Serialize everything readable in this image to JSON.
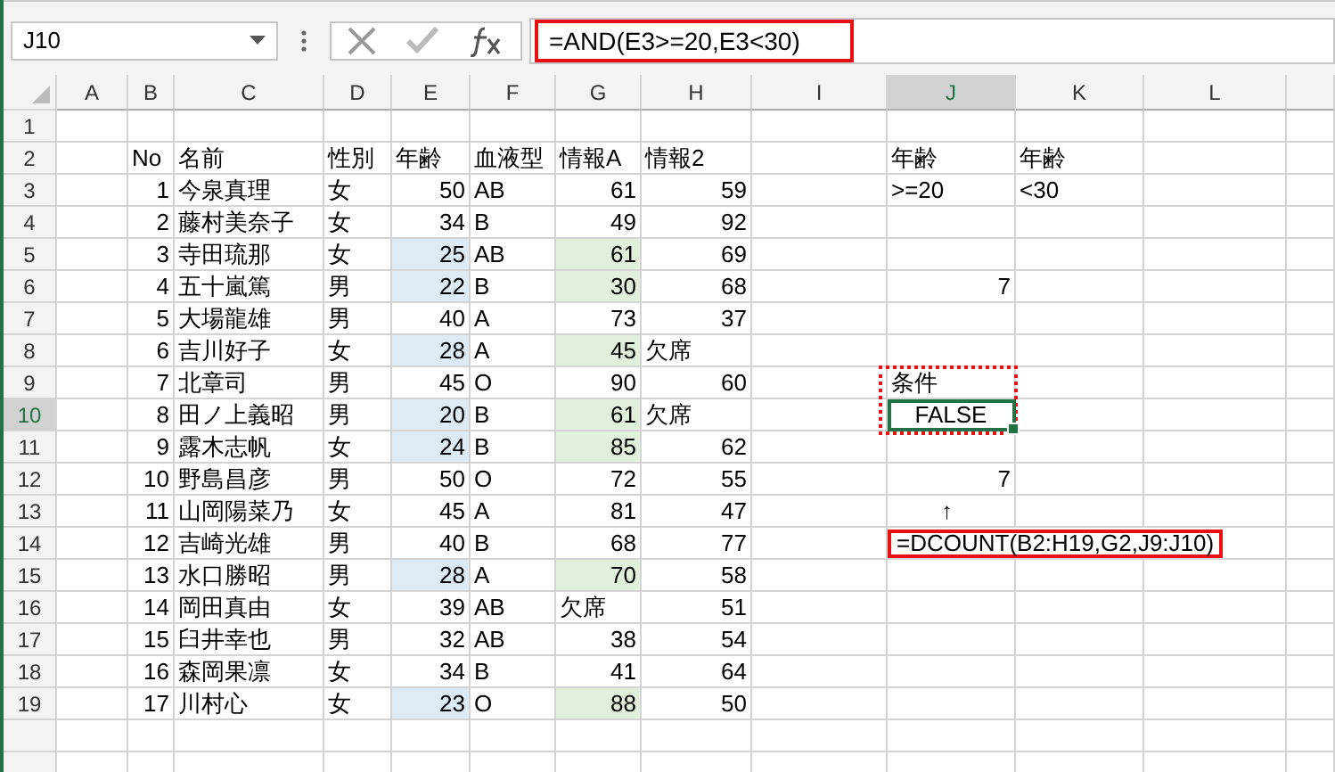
{
  "name_box": {
    "value": "J10"
  },
  "formula_bar": {
    "value": "=AND(E3>=20,E3<30)",
    "highlighted": true
  },
  "sheet": {
    "columns": [
      {
        "label": "A",
        "selected": false
      },
      {
        "label": "B",
        "selected": false
      },
      {
        "label": "C",
        "selected": false
      },
      {
        "label": "D",
        "selected": false
      },
      {
        "label": "E",
        "selected": false
      },
      {
        "label": "F",
        "selected": false
      },
      {
        "label": "G",
        "selected": false
      },
      {
        "label": "H",
        "selected": false
      },
      {
        "label": "I",
        "selected": false
      },
      {
        "label": "J",
        "selected": true
      },
      {
        "label": "K",
        "selected": false
      },
      {
        "label": "L",
        "selected": false
      }
    ],
    "rows": [
      {
        "number": "1",
        "selected": false,
        "cells": {}
      },
      {
        "number": "2",
        "selected": false,
        "cells": {
          "B": {
            "text": "No",
            "kind": "text"
          },
          "C": {
            "text": "名前",
            "kind": "text"
          },
          "D": {
            "text": "性別",
            "kind": "text"
          },
          "E": {
            "text": "年齢",
            "kind": "text"
          },
          "F": {
            "text": "血液型",
            "kind": "text"
          },
          "G": {
            "text": "情報A",
            "kind": "text"
          },
          "H": {
            "text": "情報2",
            "kind": "text"
          },
          "J": {
            "text": "年齢",
            "kind": "text"
          },
          "K": {
            "text": "年齢",
            "kind": "text"
          }
        }
      },
      {
        "number": "3",
        "selected": false,
        "cells": {
          "B": {
            "text": "1",
            "kind": "number"
          },
          "C": {
            "text": "今泉真理",
            "kind": "text"
          },
          "D": {
            "text": "女",
            "kind": "text"
          },
          "E": {
            "text": "50",
            "kind": "number"
          },
          "F": {
            "text": "AB",
            "kind": "text"
          },
          "G": {
            "text": "61",
            "kind": "number"
          },
          "H": {
            "text": "59",
            "kind": "number"
          },
          "J": {
            "text": ">=20",
            "kind": "text"
          },
          "K": {
            "text": "<30",
            "kind": "text"
          }
        }
      },
      {
        "number": "4",
        "selected": false,
        "cells": {
          "B": {
            "text": "2",
            "kind": "number"
          },
          "C": {
            "text": "藤村美奈子",
            "kind": "text"
          },
          "D": {
            "text": "女",
            "kind": "text"
          },
          "E": {
            "text": "34",
            "kind": "number"
          },
          "F": {
            "text": "B",
            "kind": "text"
          },
          "G": {
            "text": "49",
            "kind": "number"
          },
          "H": {
            "text": "92",
            "kind": "number"
          }
        }
      },
      {
        "number": "5",
        "selected": false,
        "cells": {
          "B": {
            "text": "3",
            "kind": "number"
          },
          "C": {
            "text": "寺田琉那",
            "kind": "text"
          },
          "D": {
            "text": "女",
            "kind": "text"
          },
          "E": {
            "text": "25",
            "kind": "number",
            "color": "#ddebf7"
          },
          "F": {
            "text": "AB",
            "kind": "text"
          },
          "G": {
            "text": "61",
            "kind": "number",
            "color": "#e2efda"
          },
          "H": {
            "text": "69",
            "kind": "number"
          }
        }
      },
      {
        "number": "6",
        "selected": false,
        "cells": {
          "B": {
            "text": "4",
            "kind": "number"
          },
          "C": {
            "text": "五十嵐篤",
            "kind": "text"
          },
          "D": {
            "text": "男",
            "kind": "text"
          },
          "E": {
            "text": "22",
            "kind": "number",
            "color": "#ddebf7"
          },
          "F": {
            "text": "B",
            "kind": "text"
          },
          "G": {
            "text": "30",
            "kind": "number",
            "color": "#e2efda"
          },
          "H": {
            "text": "68",
            "kind": "number"
          },
          "J": {
            "text": "7",
            "kind": "number"
          }
        }
      },
      {
        "number": "7",
        "selected": false,
        "cells": {
          "B": {
            "text": "5",
            "kind": "number"
          },
          "C": {
            "text": "大場龍雄",
            "kind": "text"
          },
          "D": {
            "text": "男",
            "kind": "text"
          },
          "E": {
            "text": "40",
            "kind": "number"
          },
          "F": {
            "text": "A",
            "kind": "text"
          },
          "G": {
            "text": "73",
            "kind": "number"
          },
          "H": {
            "text": "37",
            "kind": "number"
          }
        }
      },
      {
        "number": "8",
        "selected": false,
        "cells": {
          "B": {
            "text": "6",
            "kind": "number"
          },
          "C": {
            "text": "吉川好子",
            "kind": "text"
          },
          "D": {
            "text": "女",
            "kind": "text"
          },
          "E": {
            "text": "28",
            "kind": "number",
            "color": "#ddebf7"
          },
          "F": {
            "text": "A",
            "kind": "text"
          },
          "G": {
            "text": "45",
            "kind": "number",
            "color": "#e2efda"
          },
          "H": {
            "text": "欠席",
            "kind": "text"
          }
        }
      },
      {
        "number": "9",
        "selected": false,
        "cells": {
          "B": {
            "text": "7",
            "kind": "number"
          },
          "C": {
            "text": "北章司",
            "kind": "text"
          },
          "D": {
            "text": "男",
            "kind": "text"
          },
          "E": {
            "text": "45",
            "kind": "number"
          },
          "F": {
            "text": "O",
            "kind": "text"
          },
          "G": {
            "text": "90",
            "kind": "number"
          },
          "H": {
            "text": "60",
            "kind": "number"
          },
          "J": {
            "text": "条件",
            "kind": "text",
            "framed": true
          }
        }
      },
      {
        "number": "10",
        "selected": true,
        "cells": {
          "B": {
            "text": "8",
            "kind": "number"
          },
          "C": {
            "text": "田ノ上義昭",
            "kind": "text"
          },
          "D": {
            "text": "男",
            "kind": "text"
          },
          "E": {
            "text": "20",
            "kind": "number",
            "color": "#ddebf7"
          },
          "F": {
            "text": "B",
            "kind": "text"
          },
          "G": {
            "text": "61",
            "kind": "number",
            "color": "#e2efda"
          },
          "H": {
            "text": "欠席",
            "kind": "text"
          },
          "J": {
            "text": "FALSE",
            "kind": "boolean",
            "framed": true
          }
        }
      },
      {
        "number": "11",
        "selected": false,
        "cells": {
          "B": {
            "text": "9",
            "kind": "number"
          },
          "C": {
            "text": "露木志帆",
            "kind": "text"
          },
          "D": {
            "text": "女",
            "kind": "text"
          },
          "E": {
            "text": "24",
            "kind": "number",
            "color": "#ddebf7"
          },
          "F": {
            "text": "B",
            "kind": "text"
          },
          "G": {
            "text": "85",
            "kind": "number",
            "color": "#e2efda"
          },
          "H": {
            "text": "62",
            "kind": "number"
          }
        }
      },
      {
        "number": "12",
        "selected": false,
        "cells": {
          "B": {
            "text": "10",
            "kind": "number"
          },
          "C": {
            "text": "野島昌彦",
            "kind": "text"
          },
          "D": {
            "text": "男",
            "kind": "text"
          },
          "E": {
            "text": "50",
            "kind": "number"
          },
          "F": {
            "text": "O",
            "kind": "text"
          },
          "G": {
            "text": "72",
            "kind": "number"
          },
          "H": {
            "text": "55",
            "kind": "number"
          },
          "J": {
            "text": "7",
            "kind": "number"
          }
        }
      },
      {
        "number": "13",
        "selected": false,
        "cells": {
          "B": {
            "text": "11",
            "kind": "number"
          },
          "C": {
            "text": "山岡陽菜乃",
            "kind": "text"
          },
          "D": {
            "text": "女",
            "kind": "text"
          },
          "E": {
            "text": "45",
            "kind": "number"
          },
          "F": {
            "text": "A",
            "kind": "text"
          },
          "G": {
            "text": "81",
            "kind": "number"
          },
          "H": {
            "text": "47",
            "kind": "number"
          },
          "J": {
            "text": "↑",
            "kind": "arrow"
          }
        }
      },
      {
        "number": "14",
        "selected": false,
        "cells": {
          "B": {
            "text": "12",
            "kind": "number"
          },
          "C": {
            "text": "吉崎光雄",
            "kind": "text"
          },
          "D": {
            "text": "男",
            "kind": "text"
          },
          "E": {
            "text": "40",
            "kind": "number"
          },
          "F": {
            "text": "B",
            "kind": "text"
          },
          "G": {
            "text": "68",
            "kind": "number"
          },
          "H": {
            "text": "77",
            "kind": "number"
          },
          "J": {
            "text": "=DCOUNT(B2:H19,G2,J9:J10)",
            "kind": "callout"
          }
        }
      },
      {
        "number": "15",
        "selected": false,
        "cells": {
          "B": {
            "text": "13",
            "kind": "number"
          },
          "C": {
            "text": "水口勝昭",
            "kind": "text"
          },
          "D": {
            "text": "男",
            "kind": "text"
          },
          "E": {
            "text": "28",
            "kind": "number",
            "color": "#ddebf7"
          },
          "F": {
            "text": "A",
            "kind": "text"
          },
          "G": {
            "text": "70",
            "kind": "number",
            "color": "#e2efda"
          },
          "H": {
            "text": "58",
            "kind": "number"
          }
        }
      },
      {
        "number": "16",
        "selected": false,
        "cells": {
          "B": {
            "text": "14",
            "kind": "number"
          },
          "C": {
            "text": "岡田真由",
            "kind": "text"
          },
          "D": {
            "text": "女",
            "kind": "text"
          },
          "E": {
            "text": "39",
            "kind": "number"
          },
          "F": {
            "text": "AB",
            "kind": "text"
          },
          "G": {
            "text": "欠席",
            "kind": "text"
          },
          "H": {
            "text": "51",
            "kind": "number"
          }
        }
      },
      {
        "number": "17",
        "selected": false,
        "cells": {
          "B": {
            "text": "15",
            "kind": "number"
          },
          "C": {
            "text": "臼井幸也",
            "kind": "text"
          },
          "D": {
            "text": "男",
            "kind": "text"
          },
          "E": {
            "text": "32",
            "kind": "number"
          },
          "F": {
            "text": "AB",
            "kind": "text"
          },
          "G": {
            "text": "38",
            "kind": "number"
          },
          "H": {
            "text": "54",
            "kind": "number"
          }
        }
      },
      {
        "number": "18",
        "selected": false,
        "cells": {
          "B": {
            "text": "16",
            "kind": "number"
          },
          "C": {
            "text": "森岡果凛",
            "kind": "text"
          },
          "D": {
            "text": "女",
            "kind": "text"
          },
          "E": {
            "text": "34",
            "kind": "number"
          },
          "F": {
            "text": "B",
            "kind": "text"
          },
          "G": {
            "text": "41",
            "kind": "number"
          },
          "H": {
            "text": "64",
            "kind": "number"
          }
        }
      },
      {
        "number": "19",
        "selected": false,
        "cells": {
          "B": {
            "text": "17",
            "kind": "number"
          },
          "C": {
            "text": "川村心",
            "kind": "text"
          },
          "D": {
            "text": "女",
            "kind": "text"
          },
          "E": {
            "text": "23",
            "kind": "number",
            "color": "#ddebf7"
          },
          "F": {
            "text": "O",
            "kind": "text"
          },
          "G": {
            "text": "88",
            "kind": "number",
            "color": "#e2efda"
          },
          "H": {
            "text": "50",
            "kind": "number"
          }
        }
      }
    ]
  }
}
